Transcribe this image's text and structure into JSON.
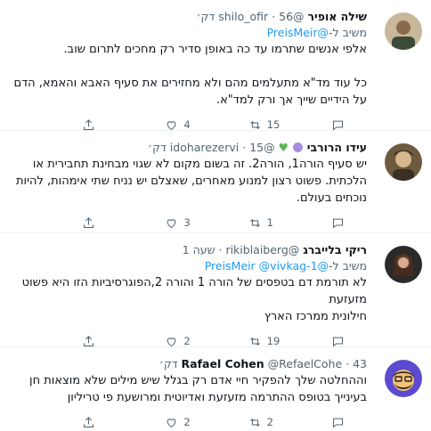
{
  "tweets": [
    {
      "name": "שילה אופיר",
      "handle": "@shilo_ofir",
      "time": "56 דק׳",
      "reply_prefix": "משיב ל-",
      "reply_to": "@PreisMeir",
      "text": "אלפי אנשים שתרמו עד כה באופן סדיר רק מחכים לתרום שוב.\n\nכל עוד מד\"א מתעלמים מהם ולא מחזירים את סעיף האבא והאמא, הדם על הידיים שייך אך ורק למד\"א.",
      "replies": "",
      "retweets": "15",
      "likes": "4"
    },
    {
      "name": "עידו הרורבי",
      "handle": "@idoharezervi",
      "time": "15 דק׳",
      "text": "יש סעיף הורה1, הורה2. זה בשום מקום לא שגוי מבחינת תחבירית או הלכתית. פשוט רצון למנוע מאחרים, שאצלם יש נניח שתי אימהות, להיות נוכחים בעולם.",
      "replies": "",
      "retweets": "1",
      "likes": "3"
    },
    {
      "name": "ריקי בלייברג",
      "handle": "@rikiblaiberg",
      "time": "שעה 1",
      "reply_prefix": "משיב ל-",
      "reply_to": "@PreisMeir",
      "reply_to2": "@vivkag-1",
      "text": "לא תורמת דם בטפסים של הורה 1 והורה 2,הפוגרסיביות הזו היא פשוט מזעזעת\nחילונית ממרכז הארץ",
      "replies": "",
      "retweets": "19",
      "likes": "2"
    },
    {
      "name": "Rafael Cohen",
      "handle": "@RefaelCohe",
      "time": "43 דק׳",
      "text": "וההחלטה שלך להפקיר חיי אדם רק בגלל שיש מילים שלא מוצאות חן בעינייך בטופס ההתרמה מזעזעת ואדיוטית ומרושעת פי טריליון",
      "replies": "",
      "retweets": "2",
      "likes": "2"
    }
  ],
  "colors": {
    "link": "#1d9bf0",
    "muted": "#536471",
    "purple_badge": "#a98ddc",
    "green_heart": "#5ab552"
  }
}
